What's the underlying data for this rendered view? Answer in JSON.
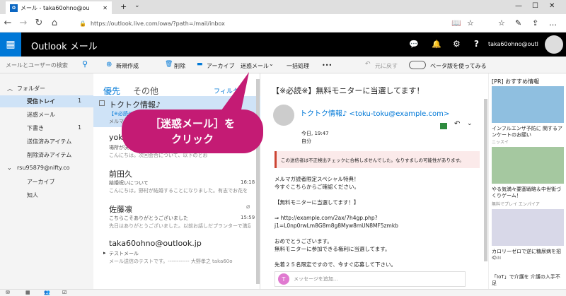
{
  "browser": {
    "tab_title": "メール - taka60ohno@ou",
    "url": "https://outlook.live.com/owa/?path=/mail/inbox"
  },
  "app": {
    "title": "Outlook メール",
    "user": "taka60ohno@outl"
  },
  "search": {
    "placeholder": "メールとユーザーの検索"
  },
  "toolbar": {
    "new": "新規作成",
    "delete": "削除",
    "archive": "アーカイブ",
    "junk": "迷惑メール",
    "sweep": "一括処理",
    "more": "•••",
    "undo": "元に戻す",
    "beta": "ベータ版を使ってみる"
  },
  "folders": {
    "header": "フォルダー",
    "inbox": "受信トレイ",
    "inbox_count": "1",
    "junk": "迷惑メール",
    "drafts": "下書き",
    "drafts_count": "1",
    "sent": "送信済みアイテム",
    "deleted": "削除済みアイテム",
    "account": "rsu95879@nifty.co",
    "archive": "アーカイブ",
    "contacts": "知人"
  },
  "list": {
    "tab_focused": "優先",
    "tab_other": "その他",
    "filter": "フィルター",
    "messages": [
      {
        "sender": "トクトク情報♪",
        "line1": "【※必読※",
        "line2": "メルマガ",
        "time": ""
      },
      {
        "sender": "yoko",
        "line1": "場所が決ま",
        "line2": "こんにちは。次回会合について、以下のとお",
        "time": ""
      },
      {
        "sender": "前田久",
        "line1": "結婚祝いについて",
        "line2": "こんにちは。野村が結婚することになりました。有志でお花を",
        "time": "16:18"
      },
      {
        "sender": "佐藤凛",
        "line1": "こちらこそありがとうございました",
        "line2": "先日はありがとうございました。以前お話しだプランターで満足し",
        "time": "15:59"
      },
      {
        "sender": "taka60ohno@outlook.jp",
        "line1": "テストメール",
        "line2": "メール送信のテストです。------------ 大野孝之 taka60o",
        "time": ""
      }
    ]
  },
  "callout": {
    "line1": "［迷惑メール］を",
    "line2": "クリック"
  },
  "reading": {
    "subject": "【※必読※】無料モニターに当選してます！",
    "from": "トクトク情報♪ <toku-toku@example.com>",
    "date": "今日, 19:47",
    "to": "自分",
    "warning": "この送信者は不正検出チェックに合格しませんでした。なりすましの可能性があります。",
    "body": [
      "メルマガ読者限定スペシャル特典！",
      "今すぐこちらからご確認ください。",
      "",
      "【無料モニターに当選してます！】",
      "",
      "⇒ http://example.com/2ax/7h4gp.php?",
      "j1=L0np0rwLm8G8m8g8Myw8mUN8MF5zmkb",
      "",
      "おめでとうございます。",
      "無料モニターに参加できる権利に当選してます。",
      "",
      "先着２５名限定ですので、今すぐ応募して下さい。"
    ],
    "reply_placeholder": "メッセージを追加..."
  },
  "ads": {
    "header": "[PR] おすすめ情報",
    "ad1": "インフルエンザ予防に 関するアンケートのお願い",
    "ad1_source": "ニッスイ",
    "ad2": "やる気満々要塞戦略＆中世街づくりゲーム！",
    "ad2_source": "無料でプレイ エンパイア",
    "ad3": "カロリーゼロで逆に糖尿病を招く",
    "ad3_source": "CNN",
    "ad4": "「IoT」で介護を 介護の入手不足"
  },
  "colors": {
    "accent": "#0078d7",
    "callout": "#c41b74"
  }
}
